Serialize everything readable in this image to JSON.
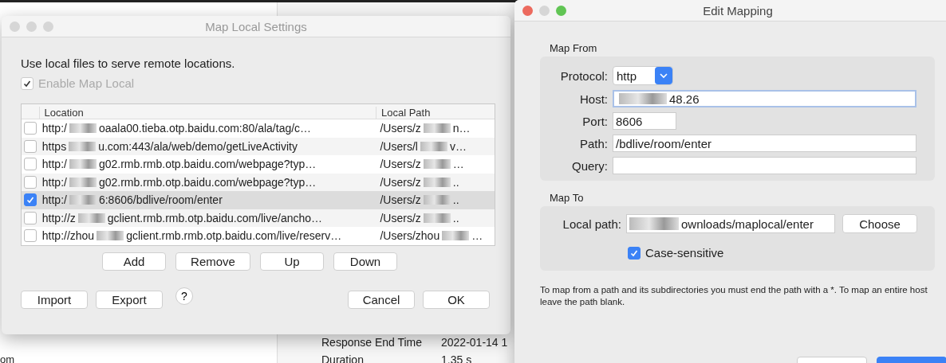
{
  "background": {
    "rows": [
      {
        "label": "Response End Time",
        "value": "2022-01-14 1"
      },
      {
        "label": "Duration",
        "value": "1.35 s"
      }
    ],
    "left_fragment": "om"
  },
  "map_local": {
    "title": "Map Local Settings",
    "intro": "Use local files to serve remote locations.",
    "enable": {
      "label": "Enable Map Local",
      "checked": true,
      "disabled": true
    },
    "table": {
      "columns": [
        "Location",
        "Local Path"
      ],
      "rows": [
        {
          "checked": false,
          "selected": false,
          "location": [
            "http:/",
            "oaala00.tieba.otp.baidu.com:80/ala/tag/c…"
          ],
          "local_path": [
            "/Users/z",
            "n…"
          ]
        },
        {
          "checked": false,
          "selected": false,
          "location": [
            "https",
            "u.com:443/ala/web/demo/getLiveActivity"
          ],
          "local_path": [
            "/Users/l",
            "v…"
          ]
        },
        {
          "checked": false,
          "selected": false,
          "location": [
            "http:/",
            "g02.rmb.rmb.otp.baidu.com/webpage?typ…"
          ],
          "local_path": [
            "/Users/z",
            "…"
          ]
        },
        {
          "checked": false,
          "selected": false,
          "location": [
            "http:/",
            "g02.rmb.rmb.otp.baidu.com/webpage?typ…"
          ],
          "local_path": [
            "/Users/z",
            ".."
          ]
        },
        {
          "checked": true,
          "selected": true,
          "location": [
            "http:/",
            "6:8606/bdlive/room/enter"
          ],
          "local_path": [
            "/Users/z",
            ".."
          ]
        },
        {
          "checked": false,
          "selected": false,
          "location": [
            "http://z",
            "gclient.rmb.rmb.otp.baidu.com/live/ancho…"
          ],
          "local_path": [
            "/Users/z",
            ".."
          ]
        },
        {
          "checked": false,
          "selected": false,
          "location": [
            "http://zhou",
            "gclient.rmb.rmb.otp.baidu.com/live/reserv…"
          ],
          "local_path": [
            "/Users/zhou",
            "…"
          ]
        }
      ]
    },
    "row_buttons": [
      "Add",
      "Remove",
      "Up",
      "Down"
    ],
    "left_buttons": [
      "Import",
      "Export"
    ],
    "help": "?",
    "right_buttons": [
      "Cancel",
      "OK"
    ]
  },
  "edit_mapping": {
    "title": "Edit Mapping",
    "map_from": {
      "label": "Map From",
      "protocol": {
        "label": "Protocol:",
        "value": "http"
      },
      "fields": [
        {
          "label": "Host:",
          "value": "48.26",
          "redacted": true,
          "focused": true,
          "kind": "wide"
        },
        {
          "label": "Port:",
          "value": "8606",
          "redacted": false,
          "focused": false,
          "kind": "short"
        },
        {
          "label": "Path:",
          "value": "/bdlive/room/enter",
          "redacted": false,
          "focused": false,
          "kind": "wide"
        },
        {
          "label": "Query:",
          "redacted": false,
          "focused": false,
          "kind": "wide"
        }
      ]
    },
    "map_to": {
      "label": "Map To",
      "local_path": {
        "label": "Local path:",
        "value": "ownloads/maplocal/enter"
      },
      "choose": "Choose",
      "case_sensitive": {
        "label": "Case-sensitive",
        "checked": true
      }
    },
    "note": "To map from a path and its subdirectories you must end the path with a *. To map an entire host leave the path blank."
  }
}
